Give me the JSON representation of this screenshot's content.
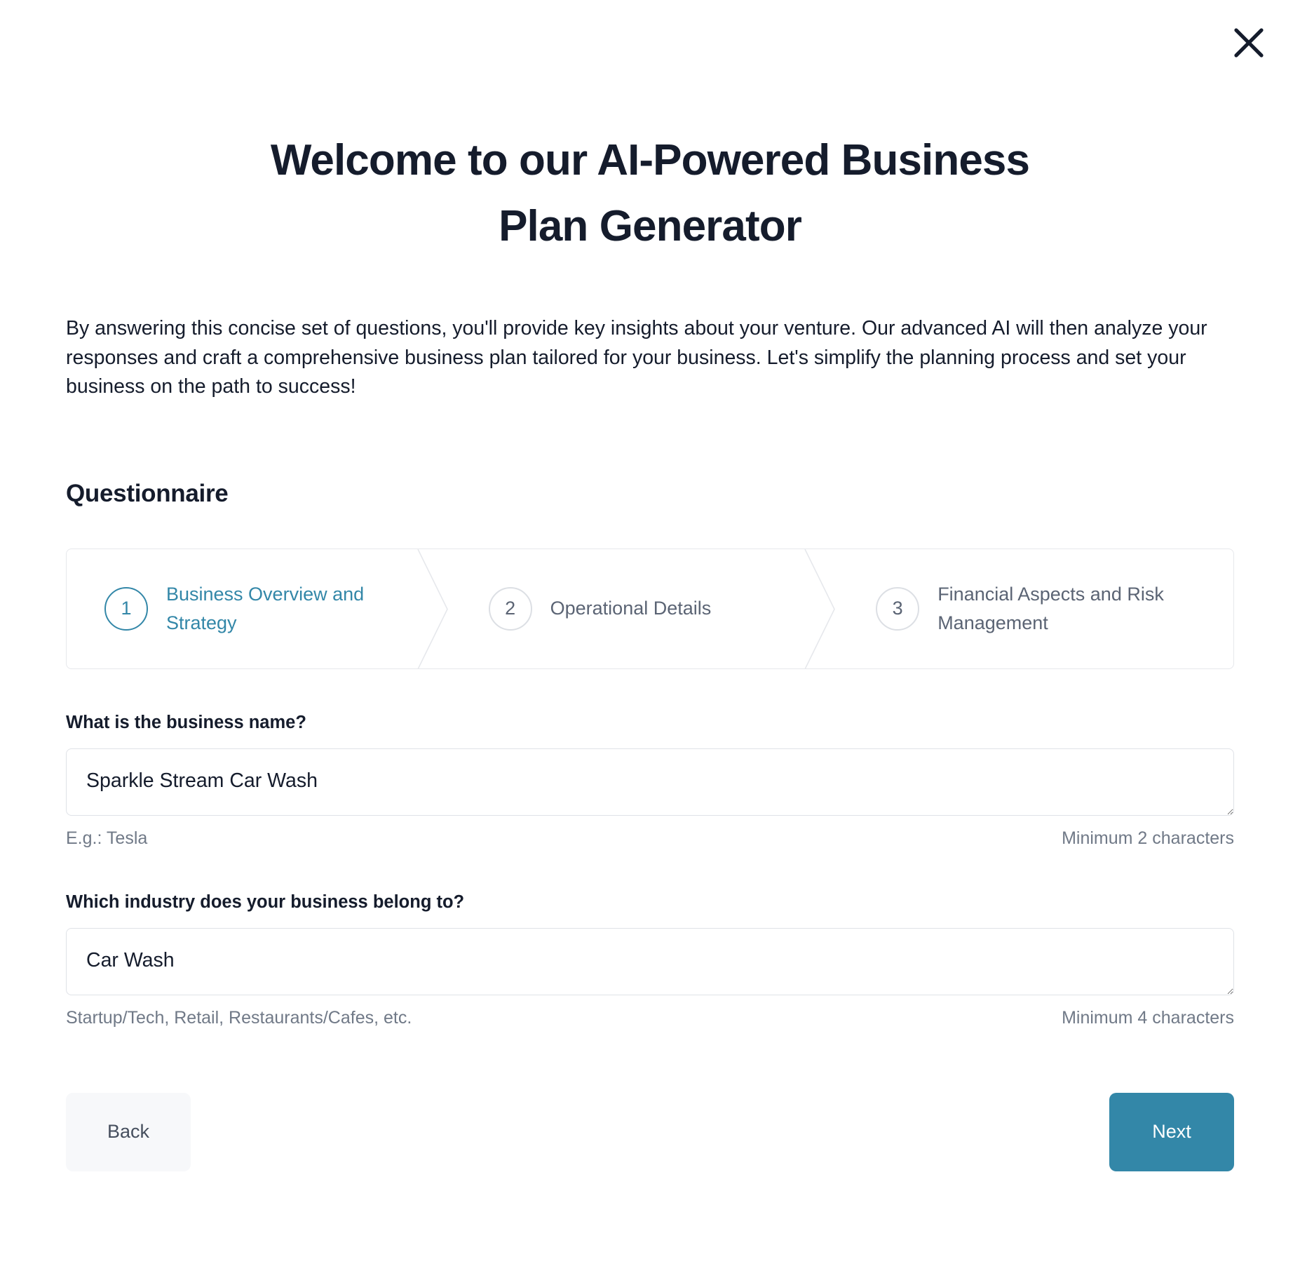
{
  "modal": {
    "close_icon": "close-icon",
    "headline": "Welcome to our AI-Powered Business Plan Generator",
    "intro": "By answering this concise set of questions, you'll provide key insights about your venture. Our advanced AI will then analyze your responses and craft a comprehensive business plan tailored for your business. Let's simplify the planning process and set your business on the path to success!",
    "section_title": "Questionnaire"
  },
  "stepper": {
    "active_index": 0,
    "accent_color": "#3387a8",
    "inactive_color": "#5b6474",
    "steps": [
      {
        "number": "1",
        "label": "Business Overview and Strategy"
      },
      {
        "number": "2",
        "label": "Operational Details"
      },
      {
        "number": "3",
        "label": "Financial Aspects and Risk Management"
      }
    ]
  },
  "form": {
    "fields": [
      {
        "label": "What is the business name?",
        "value": "Sparkle Stream Car Wash",
        "placeholder": "",
        "helper_left": "E.g.: Tesla",
        "helper_right": "Minimum 2 characters"
      },
      {
        "label": "Which industry does your business belong to?",
        "value": "Car Wash",
        "placeholder": "",
        "helper_left": "Startup/Tech, Retail, Restaurants/Cafes, etc.",
        "helper_right": "Minimum 4 characters"
      }
    ]
  },
  "footer": {
    "back_label": "Back",
    "next_label": "Next",
    "next_color": "#3387a8",
    "back_bg": "#f7f8fa"
  }
}
